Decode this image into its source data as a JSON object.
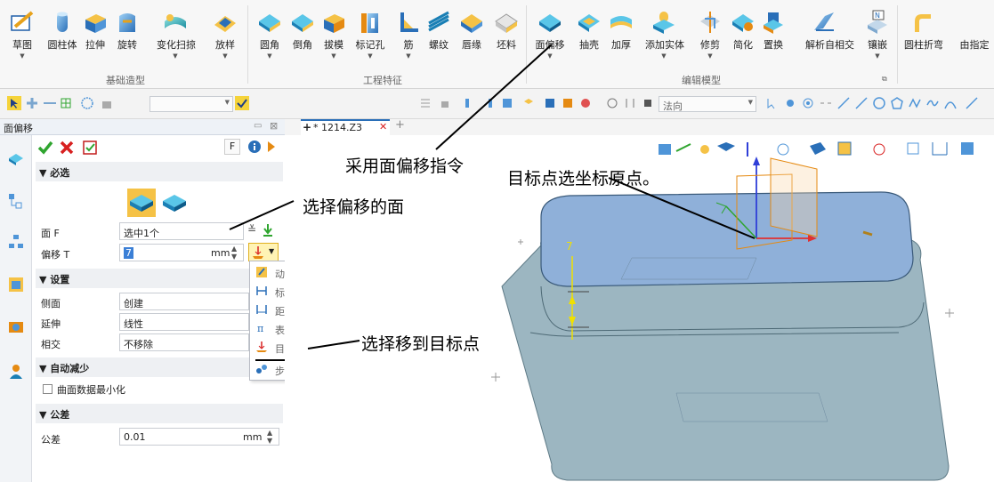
{
  "ribbon": {
    "items": [
      {
        "label": "草图",
        "icon": "sketch-icon",
        "has_arrow": true
      },
      {
        "label": "圆柱体",
        "icon": "cylinder-icon",
        "has_arrow": false
      },
      {
        "label": "拉伸",
        "icon": "extrude-icon",
        "has_arrow": false
      },
      {
        "label": "旋转",
        "icon": "revolve-icon",
        "has_arrow": false
      },
      {
        "label": "变化扫掠",
        "icon": "variable-sweep-icon",
        "has_arrow": true
      },
      {
        "label": "放样",
        "icon": "loft-icon",
        "has_arrow": true
      },
      {
        "label": "圆角",
        "icon": "fillet-icon",
        "has_arrow": true
      },
      {
        "label": "倒角",
        "icon": "chamfer-icon",
        "has_arrow": false
      },
      {
        "label": "拔模",
        "icon": "draft-icon",
        "has_arrow": true
      },
      {
        "label": "标记孔",
        "icon": "hole-icon",
        "has_arrow": true
      },
      {
        "label": "筋",
        "icon": "rib-icon",
        "has_arrow": true
      },
      {
        "label": "螺纹",
        "icon": "thread-icon",
        "has_arrow": false
      },
      {
        "label": "唇缘",
        "icon": "lip-icon",
        "has_arrow": false
      },
      {
        "label": "坯料",
        "icon": "stock-icon",
        "has_arrow": false
      },
      {
        "label": "面偏移",
        "icon": "face-offset-icon",
        "has_arrow": true
      },
      {
        "label": "抽壳",
        "icon": "shell-icon",
        "has_arrow": false
      },
      {
        "label": "加厚",
        "icon": "thicken-icon",
        "has_arrow": false
      },
      {
        "label": "添加实体",
        "icon": "add-solid-icon",
        "has_arrow": true
      },
      {
        "label": "修剪",
        "icon": "trim-icon",
        "has_arrow": true
      },
      {
        "label": "简化",
        "icon": "simplify-icon",
        "has_arrow": false
      },
      {
        "label": "置换",
        "icon": "replace-icon",
        "has_arrow": false
      },
      {
        "label": "解析自相交",
        "icon": "self-intersect-icon",
        "has_arrow": false
      },
      {
        "label": "镶嵌",
        "icon": "emboss-icon",
        "has_arrow": true
      },
      {
        "label": "圆柱折弯",
        "icon": "cylinder-bend-icon",
        "has_arrow": false
      },
      {
        "label": "由指定",
        "icon": "from-specified-icon",
        "has_arrow": false
      }
    ],
    "groups": [
      {
        "label": "基础造型"
      },
      {
        "label": "工程特征"
      },
      {
        "label": "编辑模型"
      }
    ]
  },
  "toolbar2": {
    "view_dropdown": "法向"
  },
  "panel": {
    "title": "面偏移",
    "f_button": "F",
    "sections": {
      "required": "▼ 必选",
      "settings": "▼ 设置",
      "auto_reduce": "▼ 自动减少",
      "tolerance": "▼ 公差"
    },
    "face_label": "面 F",
    "face_value": "选中1个",
    "offset_label": "偏移 T",
    "offset_value": "7",
    "offset_unit": "mm",
    "side_label": "侧面",
    "side_value": "创建",
    "extend_label": "延伸",
    "extend_value": "线性",
    "intersect_label": "相交",
    "intersect_value": "不移除",
    "minimize_label": "曲面数据最小化",
    "tolerance_label": "公差",
    "tolerance_value": "0.01",
    "tolerance_unit": "mm"
  },
  "menu": {
    "items": [
      {
        "label": "动态输入",
        "icon": "dynamic-input-icon"
      },
      {
        "label": "标注值",
        "icon": "dimension-value-icon"
      },
      {
        "label": "距离",
        "icon": "distance-icon"
      },
      {
        "label": "表达式",
        "icon": "expression-icon"
      },
      {
        "label": "目标点",
        "icon": "target-point-icon"
      },
      {
        "label": "步距",
        "icon": "step-icon"
      }
    ]
  },
  "doc_tab": {
    "label": "* 1214.Z3"
  },
  "annotations": {
    "command": "采用面偏移指令",
    "select_face": "选择偏移的面",
    "target_origin": "目标点选坐标原点。",
    "select_target": "选择移到目标点"
  },
  "viewport": {
    "dimension_value": "7"
  },
  "colors": {
    "top_face": "#8fb0d9",
    "side_face": "#9cb6c1",
    "x_axis": "#e03030",
    "y_axis": "#2fa52f",
    "z_axis": "#2f3fd8",
    "dimension": "#f0e000"
  }
}
